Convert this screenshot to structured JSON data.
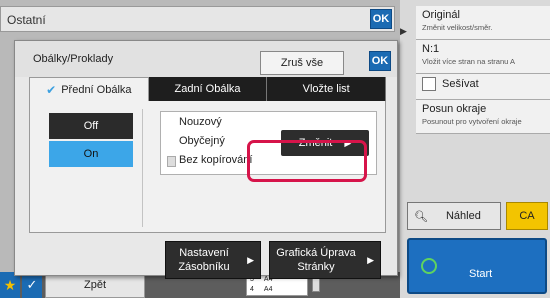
{
  "background": {
    "title": "Ostatní",
    "ok_label": "OK",
    "back_label": "Zpět",
    "mini_table": [
      [
        "3",
        "A4"
      ],
      [
        "4",
        "A4"
      ]
    ]
  },
  "dialog": {
    "title": "Obálky/Proklady",
    "clear_label": "Zruš vše",
    "ok_label": "OK",
    "tabs": [
      {
        "label": "Přední Obálka",
        "active": true
      },
      {
        "label": "Zadní Obálka",
        "active": false
      },
      {
        "label": "Vložte list",
        "active": false
      }
    ],
    "off_label": "Off",
    "on_label": "On",
    "settings": {
      "line1": "Nouzový",
      "line2": "Obyčejný",
      "line3": "Bez kopírování"
    },
    "change_label": "Změnit",
    "tray_label_line1": "Nastavení",
    "tray_label_line2": "Zásobníku",
    "graphic_label_line1": "Grafická Úprava",
    "graphic_label_line2": "Stránky"
  },
  "right_panel": {
    "items": [
      {
        "title": "Originál",
        "sub": "Změnit velikost/směr."
      },
      {
        "title": "N:1",
        "sub": "Vložit více stran na stranu A"
      },
      {
        "title": "Sešívat",
        "sub": ""
      },
      {
        "title": "Posun okraje",
        "sub": "Posunout pro vytvoření okraje"
      }
    ],
    "preview_label": "Náhled",
    "ca_label": "CA",
    "start_label": "Start"
  },
  "colors": {
    "accent_blue": "#1b6bb3",
    "on_blue": "#3ca6e8",
    "highlight": "#d6144a",
    "ca_yellow": "#f3c400"
  }
}
